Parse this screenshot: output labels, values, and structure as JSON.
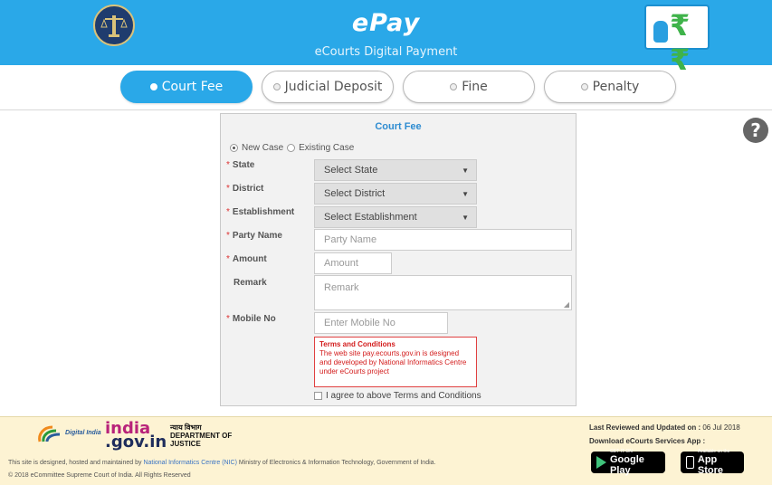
{
  "header": {
    "title": "ePay",
    "subtitle": "eCourts Digital Payment"
  },
  "tabs": [
    {
      "label": "Court Fee",
      "active": true
    },
    {
      "label": "Judicial Deposit",
      "active": false
    },
    {
      "label": "Fine",
      "active": false
    },
    {
      "label": "Penalty",
      "active": false
    }
  ],
  "help": {
    "icon": "question-icon",
    "glyph": "?"
  },
  "form": {
    "title": "Court Fee",
    "case_type": {
      "options": [
        "New Case",
        "Existing Case"
      ],
      "selected": "New Case"
    },
    "fields": {
      "state": {
        "label": "State",
        "value": "Select State",
        "required": true
      },
      "district": {
        "label": "District",
        "value": "Select District",
        "required": true
      },
      "establishment": {
        "label": "Establishment",
        "value": "Select Establishment",
        "required": true
      },
      "party_name": {
        "label": "Party Name",
        "placeholder": "Party Name",
        "required": true
      },
      "amount": {
        "label": "Amount",
        "placeholder": "Amount",
        "required": true
      },
      "remark": {
        "label": "Remark",
        "placeholder": "Remark",
        "required": false
      },
      "mobile": {
        "label": "Mobile No",
        "placeholder": "Enter Mobile No",
        "required": true
      }
    },
    "terms": {
      "title": "Terms and Conditions",
      "text": "The web site pay.ecourts.gov.in is designed and developed by National Informatics Centre under eCourts project"
    },
    "agree_label": "I agree to above Terms and Conditions",
    "agree_checked": false
  },
  "footer": {
    "digital_india": "Digital India",
    "india_gov_1": "india",
    "india_gov_2": ".gov.in",
    "doj_hindi": "न्याय विभाग",
    "doj_line1": "DEPARTMENT OF",
    "doj_line2": "JUSTICE",
    "line1_pre": "This site is designed, hosted and maintained by ",
    "line1_link": "National Informatics Centre (NIC)",
    "line1_post": " Ministry of Electronics & Information Technology, Government of India.",
    "copyright": "© 2018 eCommittee Supreme Court of India. All Rights Reserved",
    "updated_label": "Last Reviewed and Updated on : ",
    "updated_date": "06 Jul 2018",
    "app_label": "Download eCourts Services App :",
    "google_small": "GET IT ON",
    "google_big": "Google Play",
    "apple_small": "Available on the",
    "apple_big": "App Store"
  },
  "colors": {
    "header_blue": "#2aa8e8",
    "active_tab": "#2aa8e8",
    "panel_title": "#2e8cd1",
    "terms_red": "#d31c1c",
    "footer_bg": "#fdf3d3"
  }
}
